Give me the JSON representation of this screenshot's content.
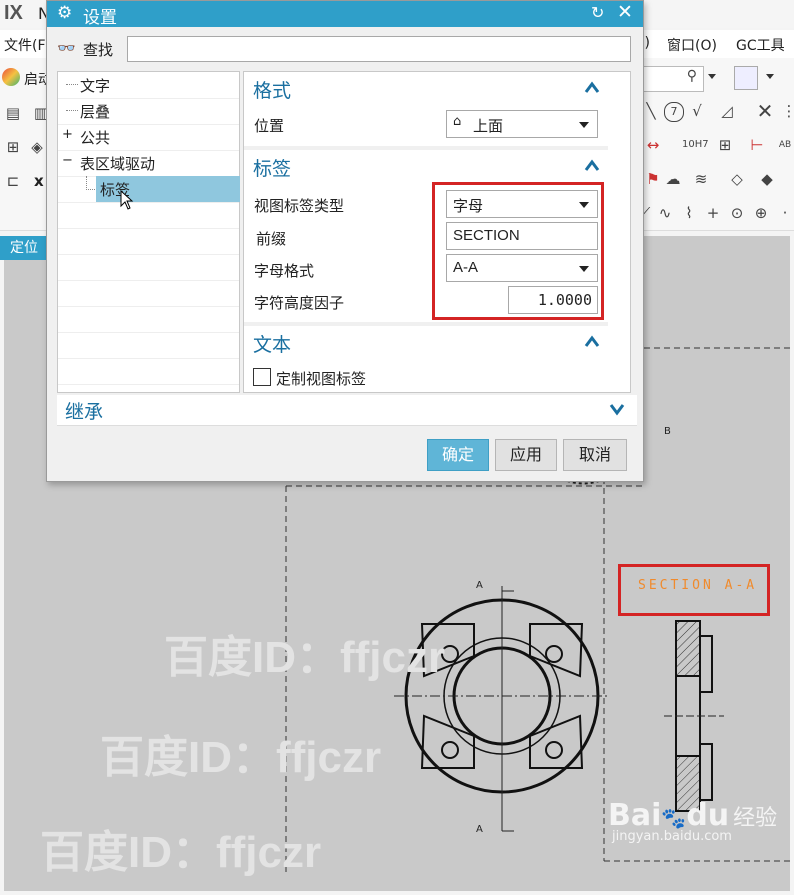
{
  "app": {
    "logo": "IX",
    "title_fragment": "N",
    "menus": [
      "文件(F",
      "P)",
      "窗口(O)",
      "GC工具"
    ],
    "ribbon_start": "启动",
    "toolbar_x": "x",
    "cmd_label": "定位",
    "drawing_label_b": "B",
    "section_label": "SECTION A-A",
    "axis_label_top": "A",
    "axis_label_bottom": "A"
  },
  "dialog": {
    "title": "设置",
    "search_label": "查找",
    "search_value": "",
    "tree": [
      {
        "label": "文字",
        "expander": "",
        "selected": false
      },
      {
        "label": "层叠",
        "expander": "",
        "selected": false
      },
      {
        "label": "公共",
        "expander": "+",
        "selected": false
      },
      {
        "label": "表区域驱动",
        "expander": "−",
        "selected": false
      },
      {
        "label": "标签",
        "expander": "",
        "selected": true
      }
    ],
    "format": {
      "title": "格式",
      "position_label": "位置",
      "position_value": "上面"
    },
    "label_section": {
      "title": "标签",
      "view_label_type_label": "视图标签类型",
      "view_label_type_value": "字母",
      "prefix_label": "前缀",
      "prefix_value": "SECTION",
      "letter_format_label": "字母格式",
      "letter_format_value": "A-A",
      "char_height_label": "字符高度因子",
      "char_height_value": "1.0000"
    },
    "text_section": {
      "title": "文本",
      "custom_label": "定制视图标签"
    },
    "inherit": "继承",
    "buttons": {
      "ok": "确定",
      "apply": "应用",
      "cancel": "取消"
    }
  },
  "watermarks": [
    "百度ID：ffjczr",
    "百度ID：ffjczr",
    "百度ID：ffjczr"
  ],
  "brand": {
    "baidu": "Bai",
    "baidu_du": "du",
    "jingyan": "经验",
    "url": "jingyan.baidu.com"
  },
  "colors": {
    "accent": "#2f9fc9",
    "highlight_red": "#d42424",
    "section_orange": "#f08a2c",
    "section_title": "#1a6fa0"
  }
}
